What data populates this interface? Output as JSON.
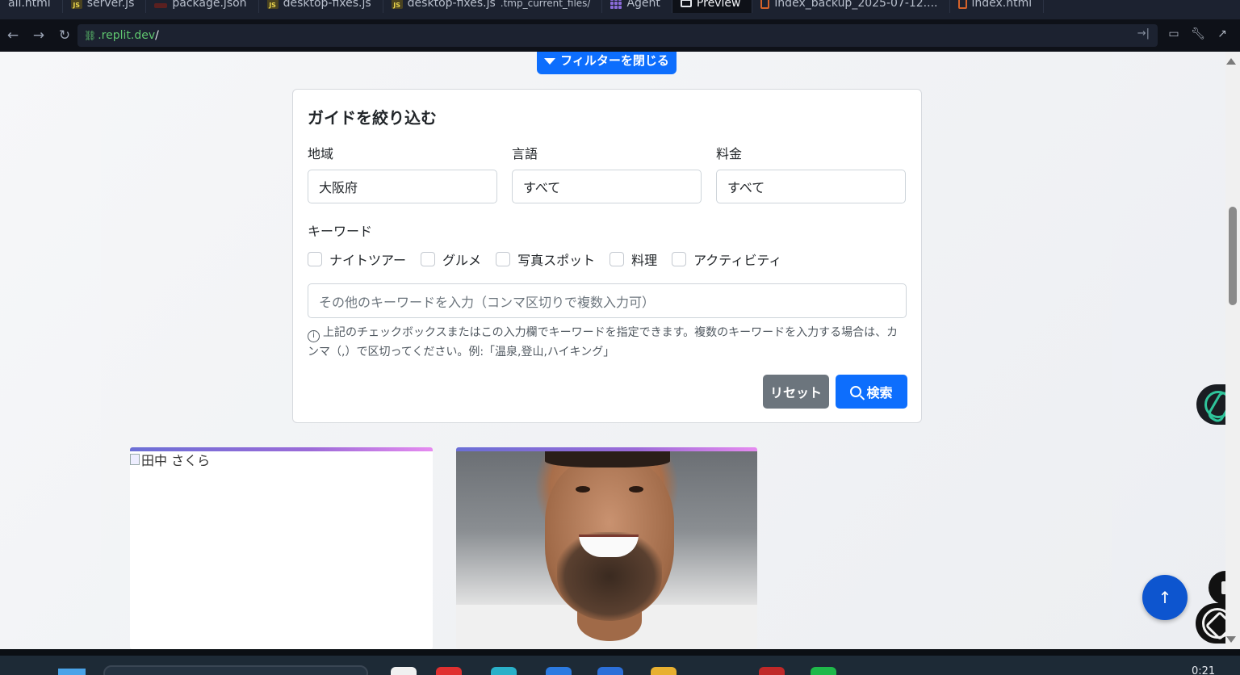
{
  "editor_tabs": [
    {
      "label": "ail.html",
      "badge": "none"
    },
    {
      "label": "server.js",
      "badge": "js"
    },
    {
      "label": "package.json",
      "badge": "json"
    },
    {
      "label": "desktop-fixes.js",
      "badge": "js"
    },
    {
      "label": "desktop-fixes.js",
      "suffix": ".tmp_current_files/",
      "badge": "js"
    },
    {
      "label": "Agent",
      "badge": "agent"
    },
    {
      "label": "Preview",
      "badge": "monitor",
      "active": true
    },
    {
      "label": "index_backup_2025-07-12....",
      "badge": "html"
    },
    {
      "label": "index.html",
      "badge": "html"
    }
  ],
  "address_bar": {
    "url_host": ".replit.dev",
    "url_path": "/"
  },
  "filter": {
    "close_button_label": "フィルターを閉じる",
    "title": "ガイドを絞り込む",
    "region_label": "地域",
    "region_value": "大阪府",
    "language_label": "言語",
    "language_value": "すべて",
    "price_label": "料金",
    "price_value": "すべて",
    "keyword_label": "キーワード",
    "keywords": [
      "ナイトツアー",
      "グルメ",
      "写真スポット",
      "料理",
      "アクティビティ"
    ],
    "keyword_placeholder": "その他のキーワードを入力（コンマ区切りで複数入力可）",
    "help_text": "上記のチェックボックスまたはこの入力欄でキーワードを指定できます。複数のキーワードを入力する場合は、カンマ（,）で区切ってください。例:「温泉,登山,ハイキング」",
    "reset_label": "リセット",
    "search_label": "検索"
  },
  "guides": [
    {
      "alt_text": "田中 さくら",
      "image": "broken"
    },
    {
      "alt_text": "",
      "image": "portrait"
    }
  ],
  "colors": {
    "primary": "#0d6efd",
    "secondary": "#6c757d",
    "card_stripe_start": "#6b6fd6",
    "card_stripe_end": "#e68bf0"
  },
  "taskbar": {
    "time": "0:21"
  }
}
